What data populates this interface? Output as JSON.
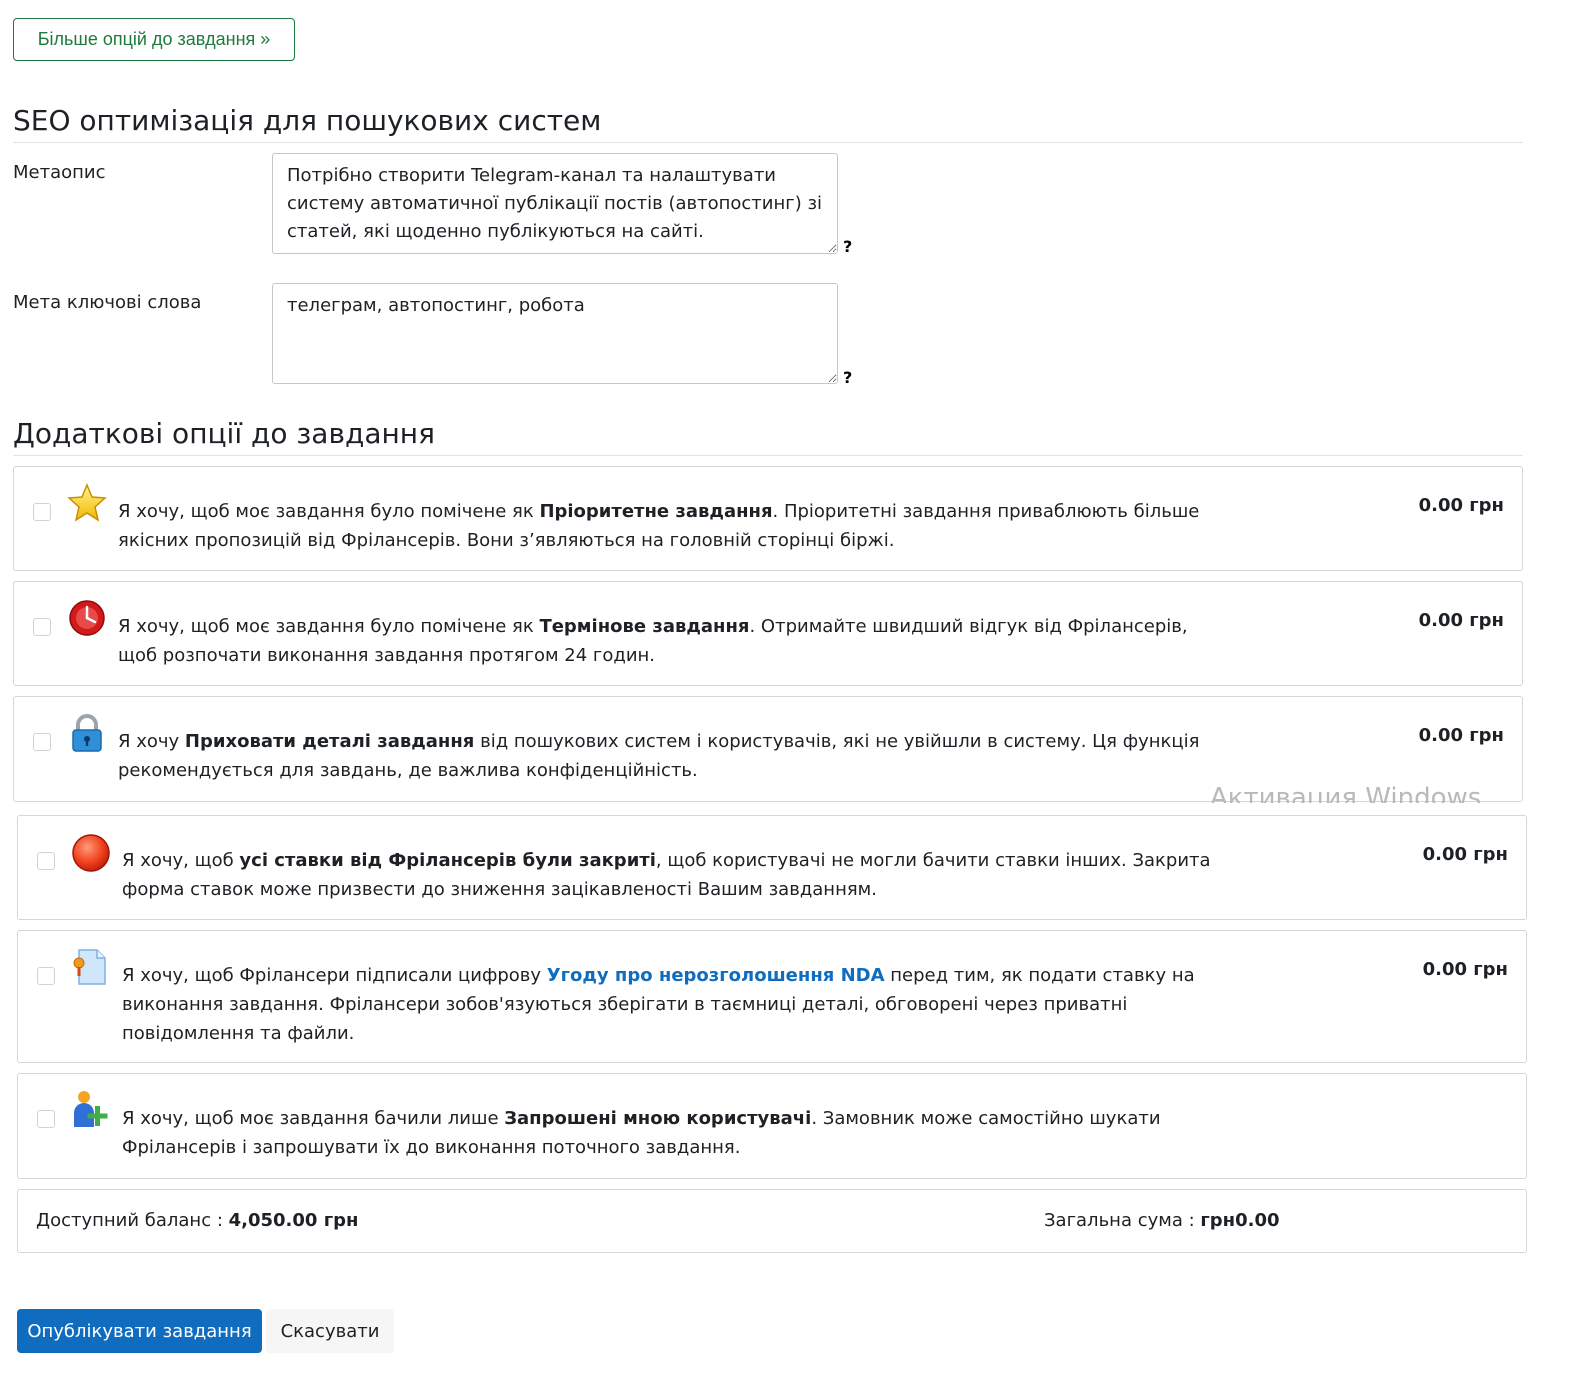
{
  "more_options_button": "Більше опцій до завдання »",
  "seo": {
    "heading": "SEO оптимізація для пошукових систем",
    "meta_description_label": "Метаопис",
    "meta_description_value": "Потрібно створити Telegram-канал та налаштувати систему автоматичної публікації постів (автопостинг) зі статей, які щоденно публікуються на сайті.",
    "meta_keywords_label": "Мета ключові слова",
    "meta_keywords_value": "телеграм, автопостинг, робота",
    "help_glyph": "?"
  },
  "options": {
    "heading": "Додаткові опції до завдання",
    "items": [
      {
        "icon": "star-icon",
        "pre": "Я хочу, щоб моє завдання було помічене як ",
        "bold": "Пріоритетне завдання",
        "post": ". Пріоритетні завдання приваблюють більше якісних пропозицій від Фрілансерів. Вони з’являються на головній сторінці біржі.",
        "price": "0.00 грн",
        "checked": false
      },
      {
        "icon": "clock-icon",
        "pre": "Я хочу, щоб моє завдання було помічене як ",
        "bold": "Термінове завдання",
        "post": ". Отримайте швидший відгук від Фрілансерів, щоб розпочати виконання завдання протягом 24 годин.",
        "price": "0.00 грн",
        "checked": false
      },
      {
        "icon": "lock-icon",
        "pre": "Я хочу ",
        "bold": "Приховати деталі завдання",
        "post": " від пошукових систем і користувачів, які не увійшли в систему. Ця функція рекомендується для завдань, де важлива конфіденційність.",
        "price": "0.00 грн",
        "checked": false
      },
      {
        "icon": "red-circle-icon",
        "pre": "Я хочу, щоб ",
        "bold": "усі ставки від Фрілансерів були закриті",
        "post": ", щоб користувачі не могли бачити ставки інших. Закрита форма ставок може призвести до зниження зацікавленості Вашим завданням.",
        "price": "0.00 грн",
        "checked": false
      },
      {
        "icon": "certificate-document-icon",
        "pre": "Я хочу, щоб Фрілансери підписали цифрову ",
        "link": "Угоду про нерозголошення NDA",
        "post": " перед тим, як подати ставку на виконання завдання. Фрілансери зобов'язуються зберігати в таємниці деталі, обговорені через приватні повідомлення та файли.",
        "price": "0.00 грн",
        "checked": false
      },
      {
        "icon": "user-add-icon",
        "pre": "Я хочу, щоб моє завдання бачили лише ",
        "bold": "Запрошені мною користувачі",
        "post": ". Замовник може самостійно шукати Фрілансерів і запрошувати їх до виконання поточного завдання.",
        "price": "",
        "checked": false
      }
    ]
  },
  "balance": {
    "available_label": "Доступний баланс : ",
    "available_value": "4,050.00 грн",
    "total_label": "Загальна сума : ",
    "total_value": "грн0.00"
  },
  "actions": {
    "publish": "Опублікувати завдання",
    "cancel": "Скасувати"
  },
  "overlay_watermark": "Активация Windows"
}
